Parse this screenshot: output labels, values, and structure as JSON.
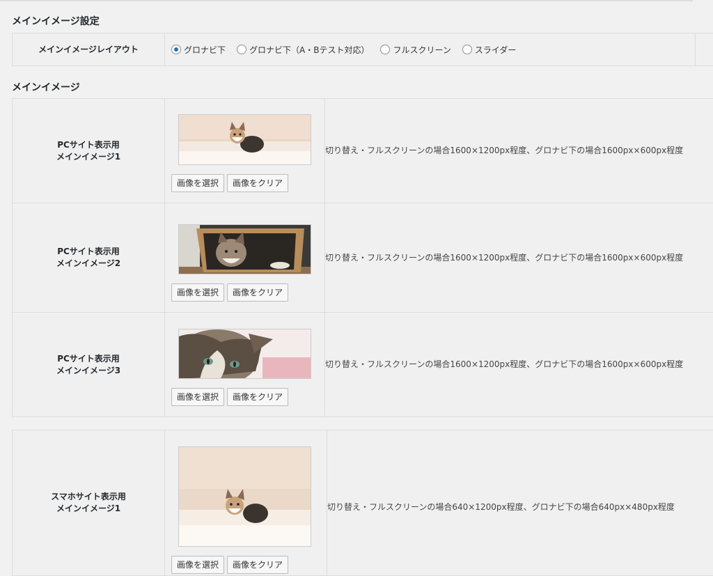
{
  "layout_section": {
    "heading": "メインイメージ設定",
    "row_label": "メインイメージレイアウト",
    "options": [
      {
        "label": "グロナビ下",
        "selected": true
      },
      {
        "label": "グロナビ下（A・Bテスト対応）",
        "selected": false
      },
      {
        "label": "フルスクリーン",
        "selected": false
      },
      {
        "label": "スライダー",
        "selected": false
      }
    ]
  },
  "images_section": {
    "heading": "メインイメージ",
    "rows": [
      {
        "label_line1": "PCサイト表示用",
        "label_line2": "メインイメージ1",
        "description": "切り替え・フルスクリーンの場合1600×1200px程度、グロナビ下の場合1600px×600px程度",
        "select_label": "画像を選択",
        "clear_label": "画像をクリア"
      },
      {
        "label_line1": "PCサイト表示用",
        "label_line2": "メインイメージ2",
        "description": "切り替え・フルスクリーンの場合1600×1200px程度、グロナビ下の場合1600px×600px程度",
        "select_label": "画像を選択",
        "clear_label": "画像をクリア"
      },
      {
        "label_line1": "PCサイト表示用",
        "label_line2": "メインイメージ3",
        "description": "切り替え・フルスクリーンの場合1600×1200px程度、グロナビ下の場合1600px×600px程度",
        "select_label": "画像を選択",
        "clear_label": "画像をクリア"
      }
    ]
  },
  "sp_section": {
    "label_line1": "スマホサイト表示用",
    "label_line2": "メインイメージ1",
    "description": "切り替え・フルスクリーンの場合640×1200px程度、グロナビ下の場合640px×480px程度",
    "select_label": "画像を選択",
    "clear_label": "画像をクリア"
  },
  "colors": {
    "radio_selected": "#2271b1",
    "background": "#f1f1f1"
  }
}
